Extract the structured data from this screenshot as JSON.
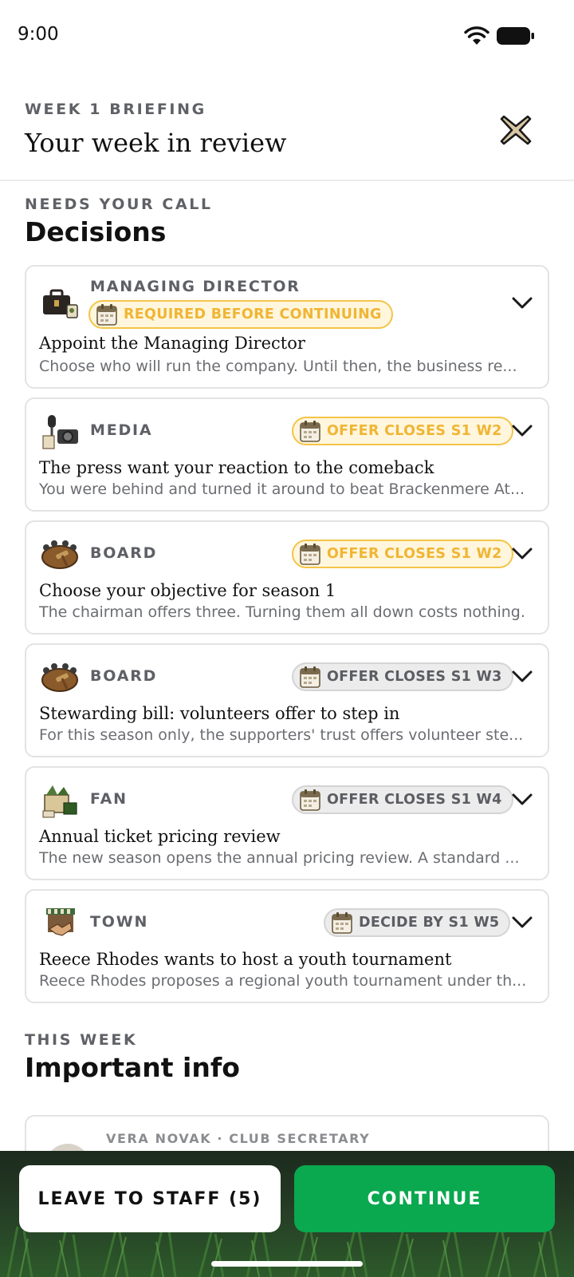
{
  "status_bar": {
    "time": "9:00"
  },
  "header": {
    "eyebrow": "WEEK 1 BRIEFING",
    "title": "Your week in review"
  },
  "decisions": {
    "eyebrow": "NEEDS YOUR CALL",
    "title": "Decisions",
    "cards": [
      {
        "category": "MANAGING DIRECTOR",
        "icon": "briefcase-icon",
        "badge": "REQUIRED BEFORE CONTINUING",
        "badge_style": "urgent",
        "title": "Appoint the Managing Director",
        "description": "Choose who will run the company. Until then, the business re..."
      },
      {
        "category": "MEDIA",
        "icon": "microphone-camera-icon",
        "badge": "OFFER CLOSES S1 W2",
        "badge_style": "urgent",
        "title": "The press want your reaction to the comeback",
        "description": "You were behind and turned it around to beat Brackenmere At..."
      },
      {
        "category": "BOARD",
        "icon": "boardroom-gavel-icon",
        "badge": "OFFER CLOSES S1 W2",
        "badge_style": "urgent",
        "title": "Choose your objective for season 1",
        "description": "The chairman offers three. Turning them all down costs nothing."
      },
      {
        "category": "BOARD",
        "icon": "boardroom-gavel-icon",
        "badge": "OFFER CLOSES S1 W3",
        "badge_style": "normal",
        "title": "Stewarding bill: volunteers offer to step in",
        "description": "For this season only, the supporters' trust offers volunteer ste..."
      },
      {
        "category": "FAN",
        "icon": "fan-scarf-icon",
        "badge": "OFFER CLOSES S1 W4",
        "badge_style": "normal",
        "title": "Annual ticket pricing review",
        "description": "The new season opens the annual pricing review. A standard ..."
      },
      {
        "category": "TOWN",
        "icon": "town-handshake-icon",
        "badge": "DECIDE BY S1 W5",
        "badge_style": "normal",
        "title": "Reece Rhodes wants to host a youth tournament",
        "description": "Reece Rhodes proposes a regional youth tournament under th..."
      }
    ]
  },
  "info": {
    "eyebrow": "THIS WEEK",
    "title": "Important info",
    "first_item_meta": "VERA NOVAK · CLUB SECRETARY"
  },
  "actions": {
    "leave_label": "LEAVE TO STAFF (5)",
    "continue_label": "CONTINUE"
  },
  "colors": {
    "accent_green": "#0aa84f",
    "urgent_amber": "#f0b534",
    "muted_text": "#6b6d72"
  }
}
